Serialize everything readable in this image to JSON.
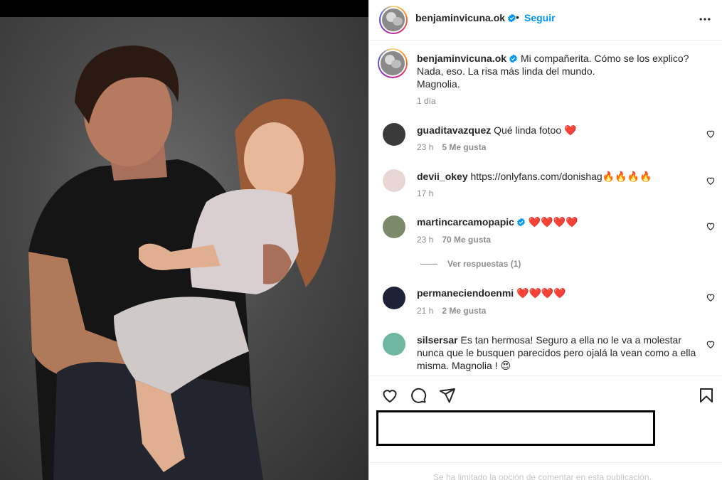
{
  "post": {
    "username": "benjaminvicuna.ok",
    "follow_label": "Seguir",
    "dot": "•",
    "caption_line1": "Mi compañerita. Cómo se los explico?",
    "caption_line2": "Nada, eso. La risa más linda del mundo.",
    "caption_line3": "Magnolia.",
    "time": "1 día"
  },
  "comments": [
    {
      "user": "guaditavazquez",
      "text": "Qué linda fotoo ❤️",
      "time": "23 h",
      "likes": "5 Me gusta"
    },
    {
      "user": "devii_okey",
      "text": "https://onlyfans.com/donishag🔥🔥🔥🔥",
      "time": "17 h",
      "likes": ""
    },
    {
      "user": "martincarcamopapic",
      "text": "❤️❤️❤️❤️",
      "time": "23 h",
      "likes": "70 Me gusta",
      "verified": true
    },
    {
      "user": "permaneciendoenmi",
      "text": "❤️❤️❤️❤️",
      "time": "21 h",
      "likes": "2 Me gusta"
    },
    {
      "user": "silsersar",
      "text": "Es tan hermosa! Seguro a ella no le va a molestar nunca que le busquen parecidos pero ojalá la vean como a ella misma. Magnolia ! 😍",
      "time": "",
      "likes": ""
    }
  ],
  "replies_label": "Ver respuestas (1)",
  "footer_hint": "Se ha limitado la opción de comentar en esta publicación.",
  "icons": [
    "more-icon",
    "verified-icon",
    "heart-icon",
    "comment-icon",
    "share-icon",
    "bookmark-icon"
  ],
  "colors": {
    "link": "#0095f6",
    "meta": "#8e8e8e",
    "verified": "#0095f6"
  }
}
